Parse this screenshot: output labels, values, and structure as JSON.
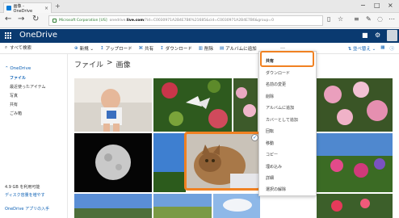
{
  "browser": {
    "tab_title": "画像 - OneDrive",
    "tab_close": "×",
    "new_tab": "+",
    "back": "←",
    "forward": "→",
    "refresh": "↻",
    "url_org": "Microsoft Corporation [US]",
    "url_prefix": "onedrive.",
    "url_host": "live.com",
    "url_path": "/?id=C0030971A2B4E7B6%21685&cid=C0030971A2B4E7B6&group=0",
    "minimize": "−",
    "maximize": "□",
    "close": "×"
  },
  "onedrive": {
    "title": "OneDrive"
  },
  "commandbar": {
    "search_label": "すべて検索",
    "commands": [
      {
        "icon": "⊕",
        "label": "新規 ⌄"
      },
      {
        "icon": "↥",
        "label": "アップロード"
      },
      {
        "icon": "⌘",
        "label": "共有"
      },
      {
        "icon": "↧",
        "label": "ダウンロード"
      },
      {
        "icon": "▥",
        "label": "削除"
      },
      {
        "icon": "▤",
        "label": "アルバムに追加"
      }
    ],
    "more": "…",
    "sort_label": "並べ替え ⌄"
  },
  "sidebar": {
    "root": "⌃ OneDrive",
    "items": [
      {
        "label": "ファイル"
      },
      {
        "label": "最近使ったアイテム"
      },
      {
        "label": "写真"
      },
      {
        "label": "共有"
      },
      {
        "label": "ごみ箱"
      }
    ],
    "storage": "4.9 GB を利用可能",
    "links": [
      "ディスク容量を増やす",
      "OneDrive アプリの入手"
    ]
  },
  "breadcrumb": {
    "root": "ファイル",
    "separator": ">",
    "current": "画像"
  },
  "context_menu": {
    "items": [
      "共有",
      "ダウンロード",
      "名前の変更",
      "削除",
      "アルバムに追加",
      "カバーとして追加",
      "回転",
      "移動",
      "コピー",
      "埋め込み",
      "詳細",
      "選択の解除"
    ]
  },
  "colors": {
    "accent": "#0a5fb4",
    "onedrive_bar": "#0a3a70",
    "highlight": "#f08122"
  }
}
